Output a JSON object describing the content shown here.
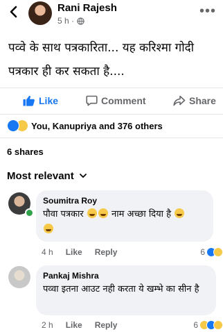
{
  "post": {
    "author": "Rani Rajesh",
    "time": "5 h ·",
    "text": "पव्वे के साथ पत्रकारिता... यह करिश्मा गोदी पत्रकार ही कर सकता है...."
  },
  "actions": {
    "like": "Like",
    "comment": "Comment",
    "share": "Share"
  },
  "reactions": {
    "summary": "You, Kanupriya and 376 others",
    "icons": [
      "like",
      "haha"
    ]
  },
  "shares": "6 shares",
  "sort": {
    "label": "Most relevant"
  },
  "comments": [
    {
      "author": "Soumitra Roy",
      "text": "पौवा पत्रकार",
      "text_after": "नाम अच्छा दिया है",
      "time": "4 h",
      "like": "Like",
      "reply": "Reply",
      "reaction_count": "6",
      "online": true
    },
    {
      "author": "Pankaj Mishra",
      "text": "पव्वा इतना आउट नही करता ये खम्भे का सीन है",
      "time": "2 h",
      "like": "Like",
      "reply": "Reply",
      "reaction_count": "6"
    }
  ],
  "colors": {
    "accent": "#1877f2",
    "secondary_text": "#65676b",
    "bubble": "#f0f2f5",
    "online": "#31a24c"
  }
}
